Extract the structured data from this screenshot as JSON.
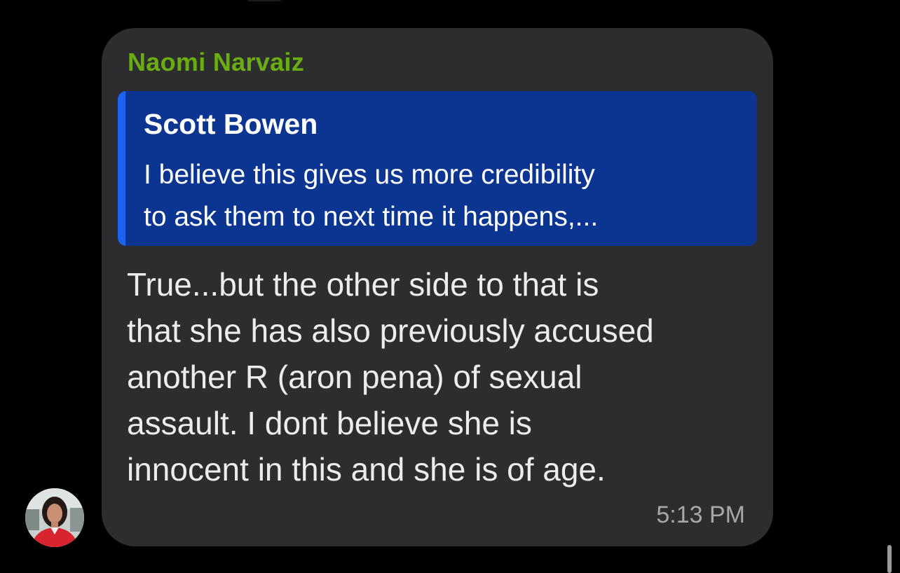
{
  "message": {
    "sender_name": "Naomi Narvaiz",
    "sender_color": "#6aad10",
    "quoted": {
      "author": "Scott Bowen",
      "text": "I believe this gives us more credibility\nto ask them to next time it happens,..."
    },
    "body": "True...but the other side to that is\nthat she has also previously accused\nanother R (aron pena) of sexual\nassault.  I dont believe she is\ninnocent in this and she is of age.",
    "timestamp": "5:13 PM"
  },
  "colors": {
    "background": "#000000",
    "bubble": "#2d2d2f",
    "quote_box": "#0c3491",
    "quote_bar": "#1c63f0",
    "timestamp": "#a7a7a9"
  }
}
